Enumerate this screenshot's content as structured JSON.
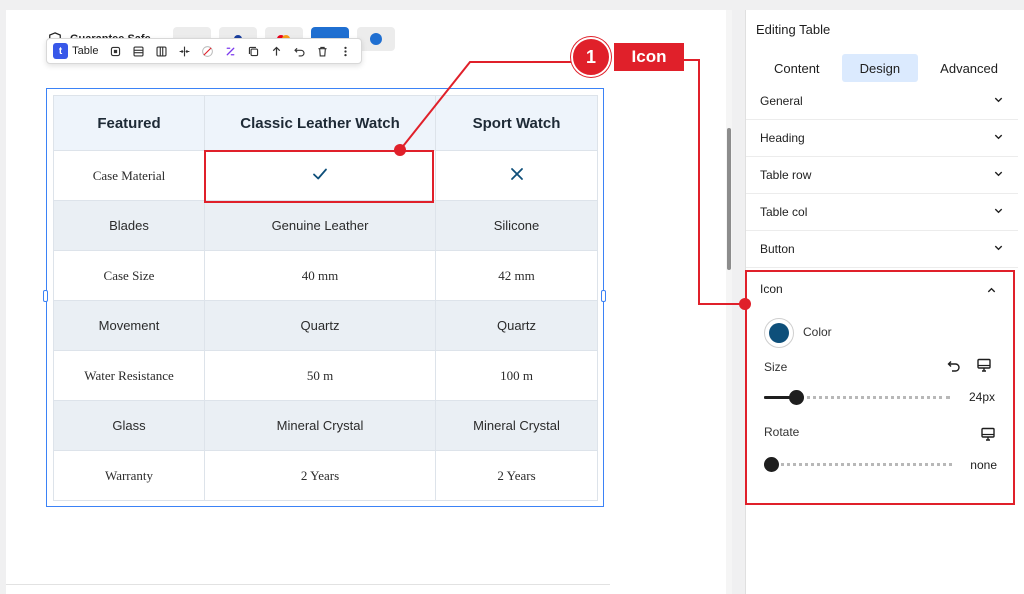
{
  "behind": {
    "title": "Guarantee Safe"
  },
  "toolbar": {
    "block_badge": "t",
    "block_label": "Table"
  },
  "table": {
    "headers": [
      "Featured",
      "Classic Leather Watch",
      "Sport Watch"
    ],
    "rows": [
      {
        "label": "Case Material",
        "col1": "check-icon",
        "col2": "cross-icon"
      },
      {
        "label": "Blades",
        "col1": "Genuine Leather",
        "col2": "Silicone"
      },
      {
        "label": "Case Size",
        "col1": "40 mm",
        "col2": "42 mm"
      },
      {
        "label": "Movement",
        "col1": "Quartz",
        "col2": "Quartz"
      },
      {
        "label": "Water Resistance",
        "col1": "50 m",
        "col2": "100 m"
      },
      {
        "label": "Glass",
        "col1": "Mineral Crystal",
        "col2": "Mineral Crystal"
      },
      {
        "label": "Warranty",
        "col1": "2 Years",
        "col2": "2 Years"
      }
    ],
    "icon_color": "#0e4f7a"
  },
  "callout": {
    "number": "1",
    "label": "Icon",
    "color": "#e0202a"
  },
  "sidebar": {
    "title": "Editing Table",
    "tabs": [
      {
        "label": "Content",
        "active": false
      },
      {
        "label": "Design",
        "active": true
      },
      {
        "label": "Advanced",
        "active": false
      }
    ],
    "panels": [
      "General",
      "Heading",
      "Table row",
      "Table col",
      "Button"
    ],
    "icon_panel": {
      "title": "Icon",
      "color_label": "Color",
      "color_value": "#0e4f7a",
      "size_label": "Size",
      "size_value": "24px",
      "size_fraction": 0.17,
      "rotate_label": "Rotate",
      "rotate_value": "none",
      "rotate_fraction": 0.0
    }
  }
}
